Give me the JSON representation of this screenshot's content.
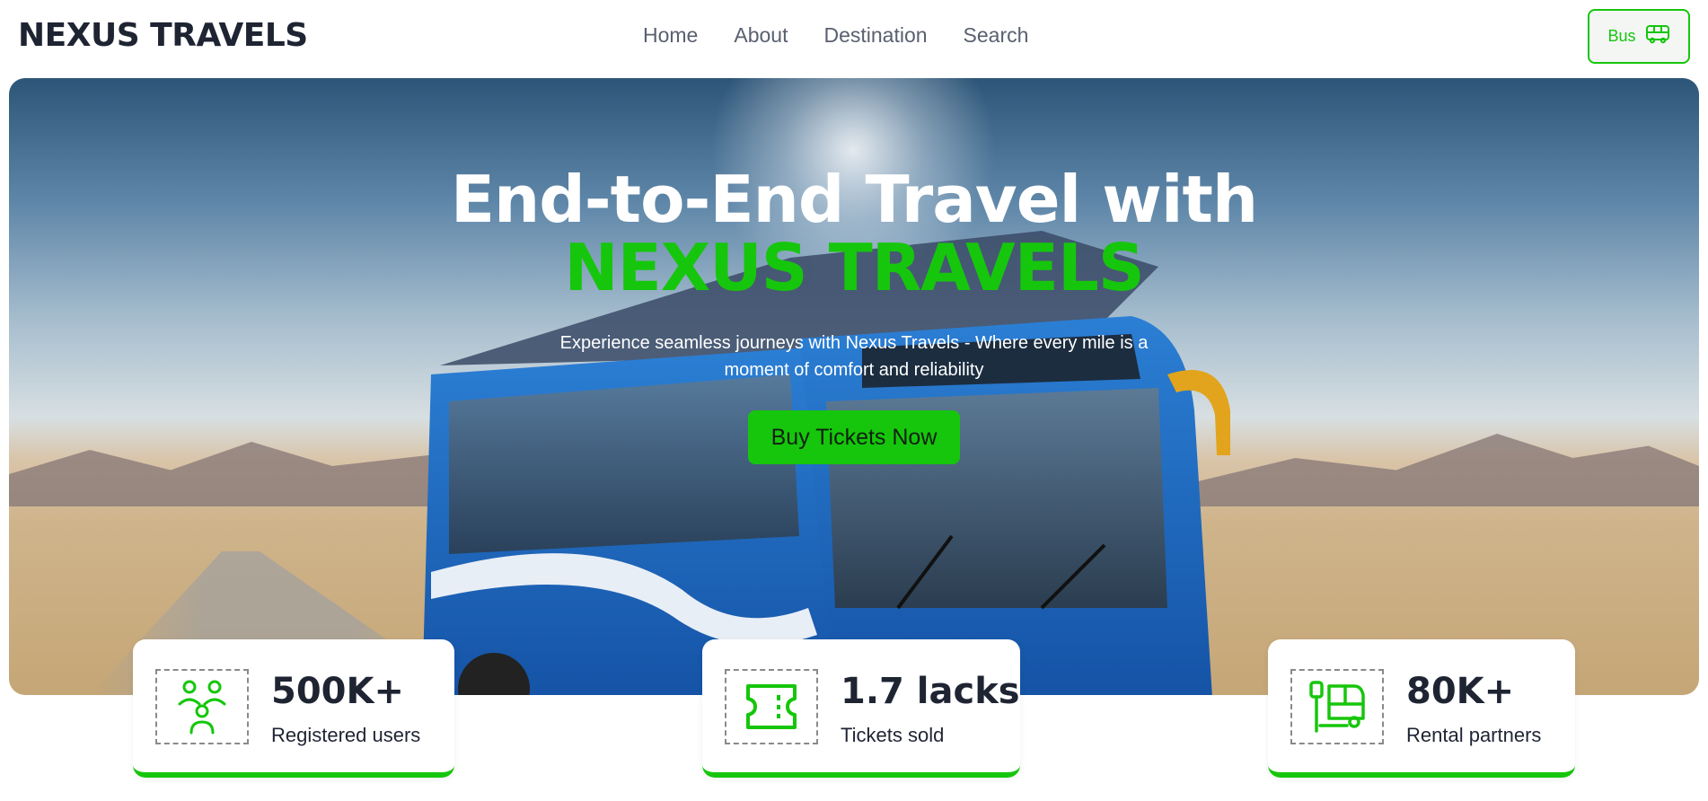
{
  "header": {
    "logo": "NEXUS TRAVELS",
    "nav": [
      "Home",
      "About",
      "Destination",
      "Search"
    ],
    "bus_button": "Bus"
  },
  "hero": {
    "title_line1": "End-to-End Travel with",
    "title_line2": "NEXUS TRAVELS",
    "subtitle": "Experience seamless journeys with Nexus Travels - Where every mile is a moment of comfort and reliability",
    "cta": "Buy Tickets Now"
  },
  "stats": [
    {
      "value": "500K+",
      "label": "Registered users",
      "icon": "users-icon"
    },
    {
      "value": "1.7 lacks",
      "label": "Tickets sold",
      "icon": "ticket-icon"
    },
    {
      "value": "80K+",
      "label": "Rental partners",
      "icon": "bus-stop-icon"
    }
  ],
  "colors": {
    "accent": "#16c60c",
    "text_dark": "#1f2433",
    "nav_text": "#5a6070"
  }
}
